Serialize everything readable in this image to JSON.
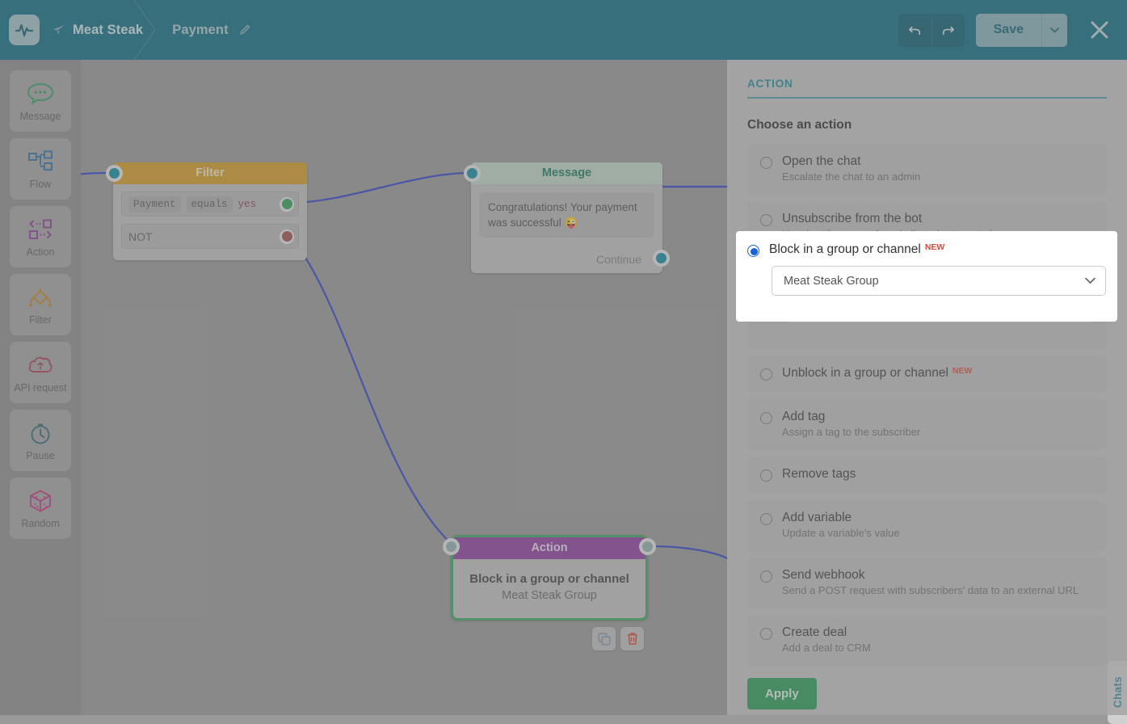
{
  "header": {
    "logo_icon": "pulse-logo-icon",
    "breadcrumb": [
      {
        "label": "Meat Steak",
        "icon": "telegram-send-icon"
      },
      {
        "label": "Payment",
        "icon": "pencil-edit-icon"
      }
    ],
    "undo_label": "undo-icon",
    "redo_label": "redo-icon",
    "save_label": "Save",
    "save_caret": "caret-down-icon",
    "close_label": "close-icon"
  },
  "sidebar": {
    "items": [
      {
        "label": "Message",
        "icon": "chat-bubble-icon",
        "color": "#2e9e62"
      },
      {
        "label": "Flow",
        "icon": "flow-tree-icon",
        "color": "#2e6ea0"
      },
      {
        "label": "Action",
        "icon": "action-arrows-icon",
        "color": "#8a3a9b"
      },
      {
        "label": "Filter",
        "icon": "filter-diamond-icon",
        "color": "#c4841d"
      },
      {
        "label": "API request",
        "icon": "api-cloud-icon",
        "color": "#ad3c55"
      },
      {
        "label": "Pause",
        "icon": "clock-icon",
        "color": "#2e6a78"
      },
      {
        "label": "Random",
        "icon": "dice-icon",
        "color": "#c0327e"
      }
    ]
  },
  "canvas": {
    "nodes": {
      "filter": {
        "title": "Filter",
        "conditions": [
          {
            "field": "Payment",
            "operator": "equals",
            "value": "yes",
            "dot_color": "#2e9e52"
          },
          {
            "field": "NOT",
            "operator": "",
            "value": "",
            "dot_color": "#a24b4b"
          }
        ]
      },
      "message": {
        "title": "Message",
        "text": "Congratulations! Your payment was successful 😜",
        "continue_label": "Continue"
      },
      "action": {
        "title": "Action",
        "action_title": "Block in a group or channel",
        "action_subtitle": "Meat Steak Group",
        "copy_label": "copy-icon",
        "delete_label": "trash-icon"
      }
    }
  },
  "panel": {
    "title": "ACTION",
    "choose_label": "Choose an action",
    "options": [
      {
        "title": "Open the chat",
        "desc": "Escalate the chat to an admin",
        "selected": false,
        "badge": ""
      },
      {
        "title": "Unsubscribe from the bot",
        "desc": "Unsubscribe a user from bulk and automated messages",
        "selected": false,
        "badge": ""
      },
      {
        "title": "Block in a group or channel",
        "desc": "",
        "selected": true,
        "badge": "NEW",
        "dropdown_value": "Meat Steak Group"
      },
      {
        "title": "Unblock in a group or channel",
        "desc": "",
        "selected": false,
        "badge": "NEW"
      },
      {
        "title": "Add tag",
        "desc": "Assign a tag to the subscriber",
        "selected": false,
        "badge": ""
      },
      {
        "title": "Remove tags",
        "desc": "",
        "selected": false,
        "badge": ""
      },
      {
        "title": "Add variable",
        "desc": "Update a variable's value",
        "selected": false,
        "badge": ""
      },
      {
        "title": "Send webhook",
        "desc": "Send a POST request with subscribers' data to an external URL",
        "selected": false,
        "badge": ""
      },
      {
        "title": "Create deal",
        "desc": "Add a deal to CRM",
        "selected": false,
        "badge": ""
      }
    ],
    "apply_label": "Apply",
    "chats_label": "Chats"
  },
  "colors": {
    "header_bg": "#0a6b80",
    "accent_teal": "#1f8799",
    "apply_green": "#279a53",
    "badge_red": "#e04a3a",
    "filter_orange": "#d29a22",
    "action_purple": "#8a3a9b",
    "edge_blue": "#2b3fc4"
  }
}
